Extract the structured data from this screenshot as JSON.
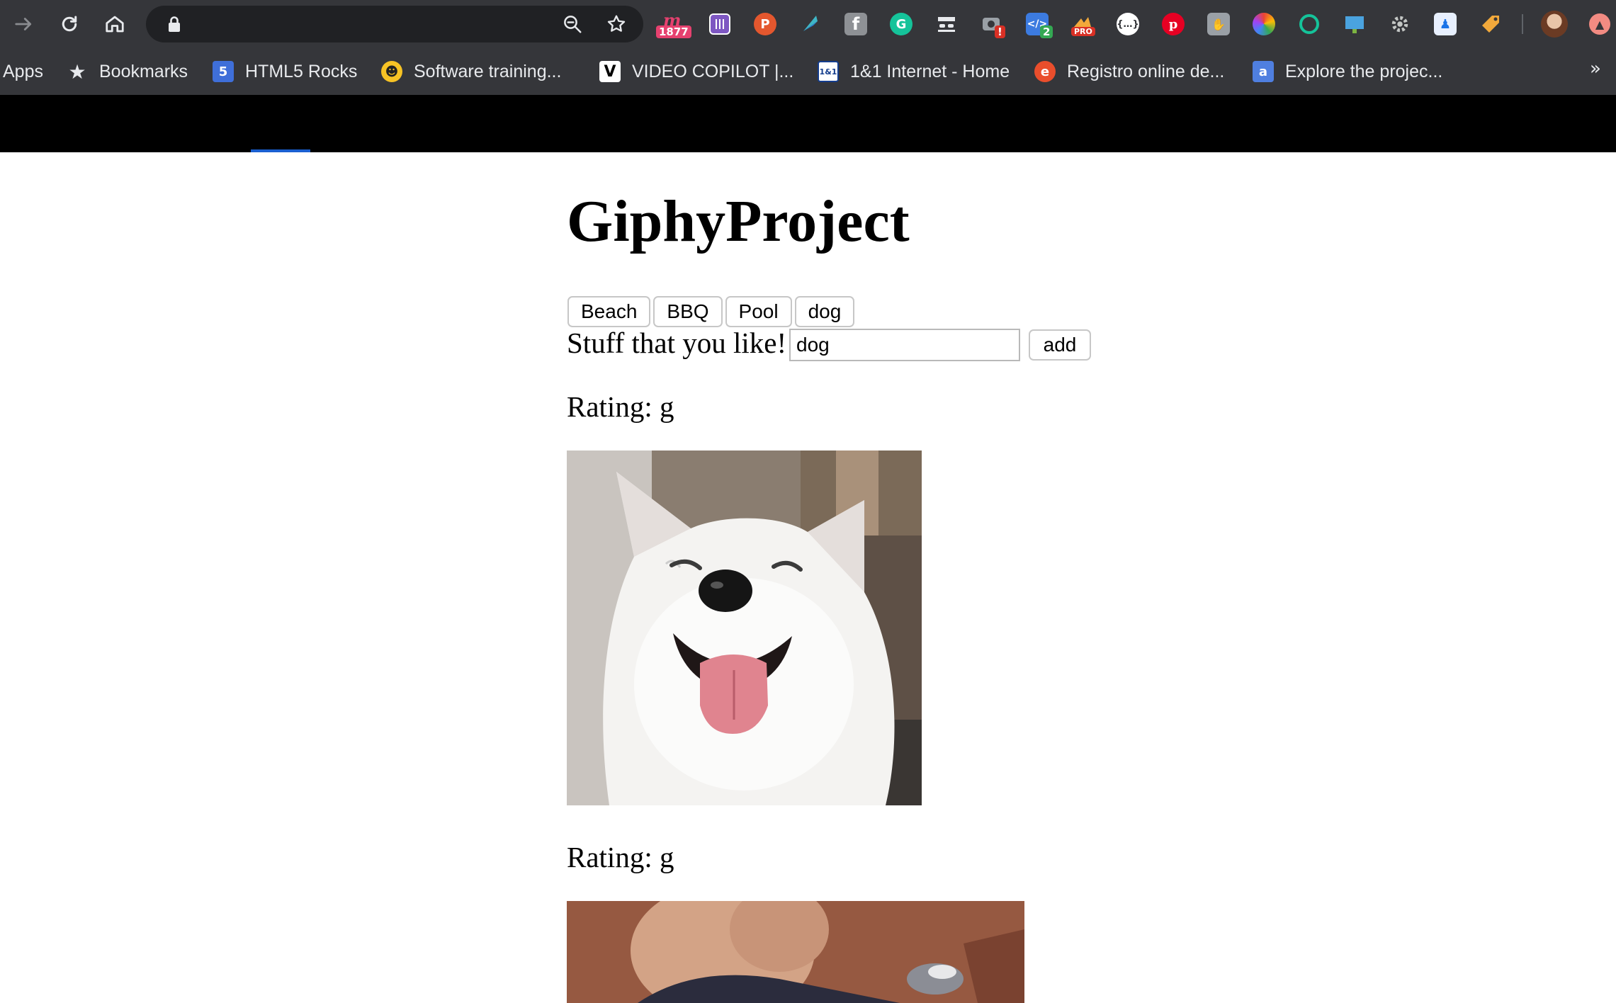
{
  "browser": {
    "bookmarks": [
      {
        "label": "Apps",
        "icon": "apps-grid-icon"
      },
      {
        "label": "Bookmarks",
        "icon": "star-icon"
      },
      {
        "label": "HTML5 Rocks",
        "icon": "html5-icon"
      },
      {
        "label": "Software training...",
        "icon": "lynda-icon"
      },
      {
        "label": "VIDEO COPILOT |...",
        "icon": "video-copilot-icon"
      },
      {
        "label": "1&1 Internet - Home",
        "icon": "1and1-icon"
      },
      {
        "label": "Registro online de...",
        "icon": "registro-icon"
      },
      {
        "label": "Explore the projec...",
        "icon": "explore-icon"
      }
    ],
    "bookmarks_more": "»",
    "extensions": {
      "badge_1877": "1877",
      "badge_alert": "!",
      "badge_2": "2",
      "pro_label": "PRO",
      "ext_p": "P",
      "ext_f": "f",
      "ext_g": "G"
    }
  },
  "page": {
    "title": "GiphyProject",
    "topics": [
      "Beach",
      "BBQ",
      "Pool",
      "dog"
    ],
    "form": {
      "label": "Stuff that you like!",
      "input_value": "dog",
      "add_label": "add"
    },
    "results": [
      {
        "rating": "Rating: g",
        "image": "samoyed-dog-gif"
      },
      {
        "rating": "Rating: g",
        "image": "dog-gif-2"
      }
    ]
  }
}
